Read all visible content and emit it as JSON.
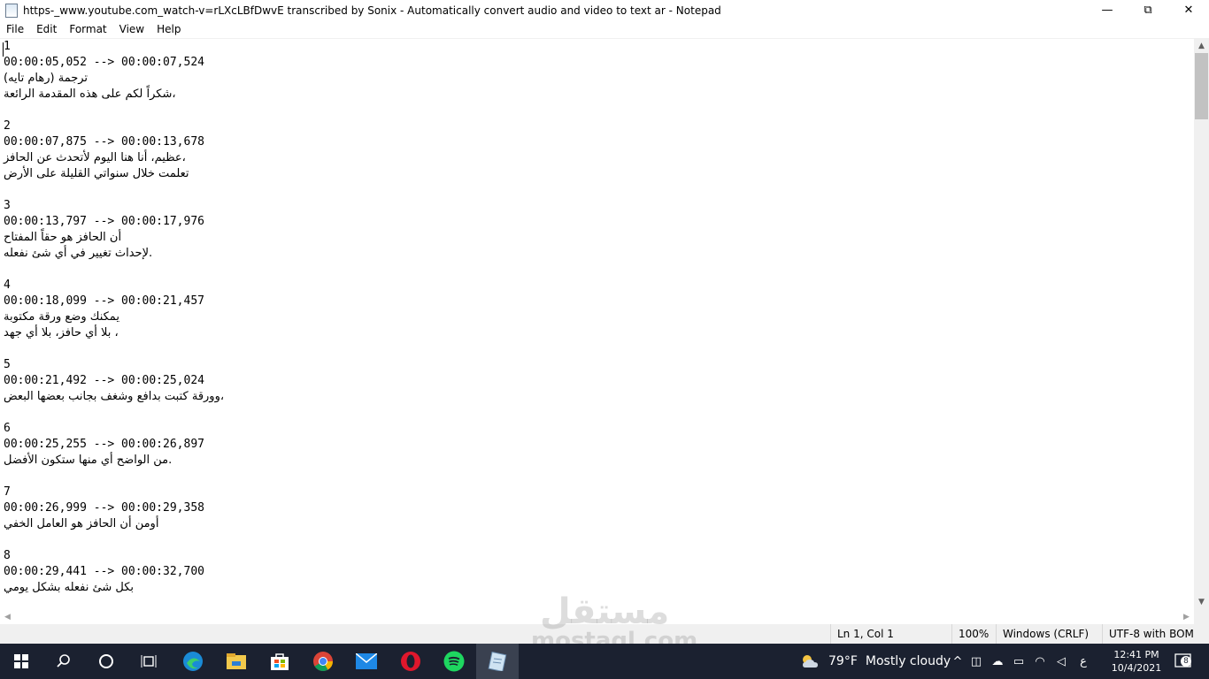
{
  "window": {
    "title": "https-_www.youtube.com_watch-v=rLXcLBfDwvE transcribed by Sonix - Automatically convert audio and video to text ar - Notepad",
    "minimize": "—",
    "maximize": "⧉",
    "close": "✕"
  },
  "menu": [
    "File",
    "Edit",
    "Format",
    "View",
    "Help"
  ],
  "editor_lines": [
    {
      "text": "1",
      "mono": true
    },
    {
      "text": "00:00:05,052 --> 00:00:07,524",
      "mono": true
    },
    {
      "text": "ترجمة (رهام تايه)",
      "mono": false
    },
    {
      "text": "شكراً لكم على هذه المقدمة الرائعة،",
      "mono": false
    },
    {
      "text": "",
      "mono": true
    },
    {
      "text": "2",
      "mono": true
    },
    {
      "text": "00:00:07,875 --> 00:00:13,678",
      "mono": true
    },
    {
      "text": "عظيم، أنا هنا اليوم لأتحدث عن الحافز،",
      "mono": false
    },
    {
      "text": "تعلمت خلال سنواتي القليلة على الأرض",
      "mono": false
    },
    {
      "text": "",
      "mono": true
    },
    {
      "text": "3",
      "mono": true
    },
    {
      "text": "00:00:13,797 --> 00:00:17,976",
      "mono": true
    },
    {
      "text": "أن الحافز هو حقاً المفتاح",
      "mono": false
    },
    {
      "text": "لإحداث تغيير في أي شئ نفعله.",
      "mono": false
    },
    {
      "text": "",
      "mono": true
    },
    {
      "text": "4",
      "mono": true
    },
    {
      "text": "00:00:18,099 --> 00:00:21,457",
      "mono": true
    },
    {
      "text": "يمكنك وضع ورقة مكتوبة",
      "mono": false
    },
    {
      "text": "بلا أي حافز، بلا أي جهد ،",
      "mono": false
    },
    {
      "text": "",
      "mono": true
    },
    {
      "text": "5",
      "mono": true
    },
    {
      "text": "00:00:21,492 --> 00:00:25,024",
      "mono": true
    },
    {
      "text": "وورقة كتبت بدافع وشغف بجانب بعضها البعض،",
      "mono": false
    },
    {
      "text": "",
      "mono": true
    },
    {
      "text": "6",
      "mono": true
    },
    {
      "text": "00:00:25,255 --> 00:00:26,897",
      "mono": true
    },
    {
      "text": "من الواضح أي منها ستكون الأفضل.",
      "mono": false
    },
    {
      "text": "",
      "mono": true
    },
    {
      "text": "7",
      "mono": true
    },
    {
      "text": "00:00:26,999 --> 00:00:29,358",
      "mono": true
    },
    {
      "text": "أومن أن الحافز هو العامل الخفي",
      "mono": false
    },
    {
      "text": "",
      "mono": true
    },
    {
      "text": "8",
      "mono": true
    },
    {
      "text": "00:00:29,441 --> 00:00:32,700",
      "mono": true
    },
    {
      "text": "بكل شئ نفعله بشكل يومي",
      "mono": false
    }
  ],
  "status": {
    "position": "Ln 1, Col 1",
    "zoom": "100%",
    "line_ending": "Windows (CRLF)",
    "encoding": "UTF-8 with BOM"
  },
  "taskbar": {
    "weather_temp": "79°F",
    "weather_text": "Mostly cloudy",
    "language": "ع",
    "time": "12:41 PM",
    "date": "10/4/2021",
    "notifications": "8",
    "apps": [
      "start-icon",
      "search-icon",
      "cortana-icon",
      "task-view-icon",
      "edge-icon",
      "file-explorer-icon",
      "store-icon",
      "chrome-icon",
      "mail-icon",
      "opera-icon",
      "spotify-icon",
      "notepad-icon"
    ]
  },
  "watermark": {
    "arabic": "مستقل",
    "latin": "mostaql.com"
  }
}
